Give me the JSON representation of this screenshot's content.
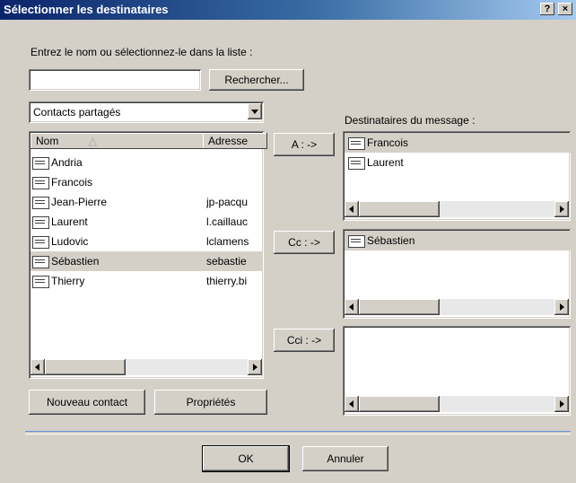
{
  "window": {
    "title": "Sélectionner les destinataires",
    "help_button": "?",
    "close_button": "×"
  },
  "search": {
    "label": "Entrez le nom ou sélectionnez-le dans la liste :",
    "input_value": "",
    "button": "Rechercher..."
  },
  "address_book": {
    "selected": "Contacts partagés"
  },
  "contacts_list": {
    "columns": [
      "Nom",
      "Adresse"
    ],
    "rows": [
      {
        "name": "Andria",
        "address": ""
      },
      {
        "name": "Francois",
        "address": ""
      },
      {
        "name": "Jean-Pierre",
        "address": "jp-pacqu"
      },
      {
        "name": "Laurent",
        "address": "l.caillauc"
      },
      {
        "name": "Ludovic",
        "address": "lclamens"
      },
      {
        "name": "Sébastien",
        "address": "sebastie"
      },
      {
        "name": "Thierry",
        "address": "thierry.bi"
      }
    ],
    "selected_index": 5
  },
  "buttons": {
    "to": "A : ->",
    "cc": "Cc : ->",
    "bcc": "Cci : ->",
    "new_contact": "Nouveau contact",
    "properties": "Propriétés",
    "ok": "OK",
    "cancel": "Annuler"
  },
  "recipients": {
    "label": "Destinataires du message :",
    "to": [
      "Francois",
      "Laurent"
    ],
    "cc": [
      "Sébastien"
    ],
    "bcc": []
  }
}
